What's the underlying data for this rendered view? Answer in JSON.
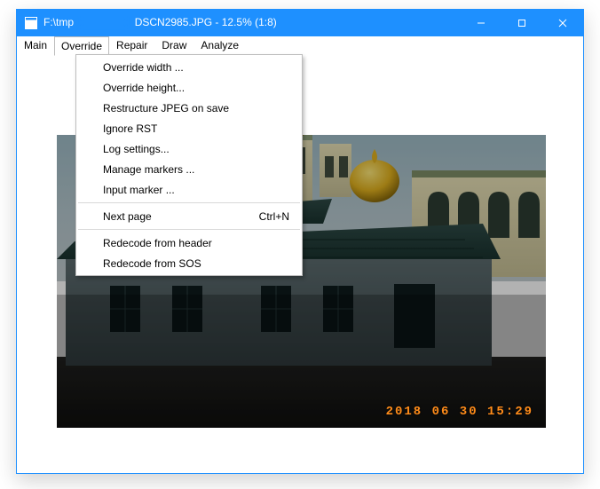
{
  "window": {
    "title_path_start": "F:\\tmp",
    "title_path_end": "DSCN2985.JPG - 12.5% (1:8)"
  },
  "menubar": {
    "items": [
      "Main",
      "Override",
      "Repair",
      "Draw",
      "Analyze"
    ],
    "open_index": 1
  },
  "dropdown": {
    "sections": [
      {
        "items": [
          {
            "label": "Override width ...",
            "accel": ""
          },
          {
            "label": "Override height...",
            "accel": ""
          },
          {
            "label": "Restructure JPEG on save",
            "accel": ""
          },
          {
            "label": "Ignore RST",
            "accel": ""
          },
          {
            "label": "Log settings...",
            "accel": ""
          },
          {
            "label": "Manage markers ...",
            "accel": ""
          },
          {
            "label": "Input marker ...",
            "accel": ""
          }
        ]
      },
      {
        "items": [
          {
            "label": "Next page",
            "accel": "Ctrl+N"
          }
        ]
      },
      {
        "items": [
          {
            "label": "Redecode from header",
            "accel": ""
          },
          {
            "label": "Redecode from SOS",
            "accel": ""
          }
        ]
      }
    ]
  },
  "image": {
    "timestamp_overlay": "2018 06 30  15:29"
  }
}
